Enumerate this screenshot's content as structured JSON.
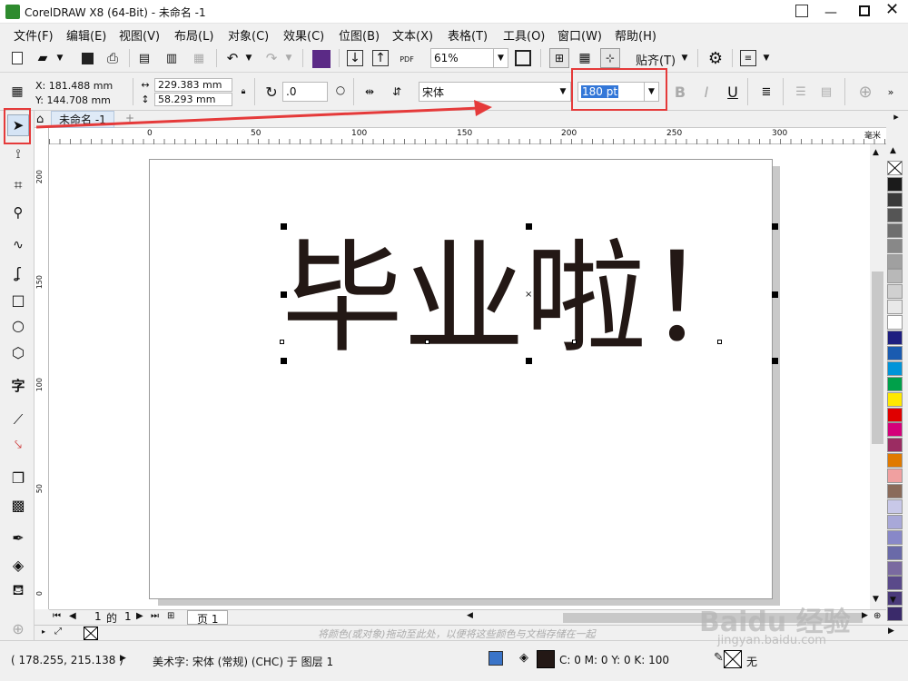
{
  "title": "CorelDRAW X8 (64-Bit) - 未命名 -1",
  "menu": [
    "文件(F)",
    "编辑(E)",
    "视图(V)",
    "布局(L)",
    "对象(C)",
    "效果(C)",
    "位图(B)",
    "文本(X)",
    "表格(T)",
    "工具(O)",
    "窗口(W)",
    "帮助(H)"
  ],
  "toolbar": {
    "zoom": "61%",
    "snap": "贴齐(T)"
  },
  "props": {
    "x": "X: 181.488 mm",
    "y": "Y: 144.708 mm",
    "w": "229.383 mm",
    "h": "58.293 mm",
    "angle": ".0",
    "font": "宋体",
    "size": "180 pt"
  },
  "tab": {
    "name": "未命名 -1"
  },
  "ruler": {
    "marks": [
      "0",
      "50",
      "100",
      "150",
      "200",
      "250",
      "300"
    ],
    "unit": "毫米",
    "vmarks": [
      "200",
      "150",
      "100",
      "50",
      "0"
    ]
  },
  "canvas_text": "毕业啦！",
  "pagenav": {
    "current": "1",
    "of": "的",
    "total": "1",
    "page_tab": "页 1"
  },
  "hint": "将颜色(或对象)拖动至此处，以便将这些颜色与文档存储在一起",
  "status": {
    "coords": "( 178.255, 215.138 )",
    "info": "美术字: 宋体 (常规) (CHC) 于 图层 1",
    "cmyk": "C: 0 M: 0 Y: 0 K: 100",
    "outline": "无"
  },
  "watermark": "Baidu 经验",
  "watermark_sub": "jingyan.baidu.com",
  "palette": [
    "#1b1b1b",
    "#3a3a3a",
    "#555555",
    "#6e6e6e",
    "#888888",
    "#a0a0a0",
    "#b8b8b8",
    "#d0d0d0",
    "#e8e8e8",
    "#ffffff",
    "#1e1e80",
    "#1a5bb0",
    "#0094d9",
    "#00a04a",
    "#ffe800",
    "#e00000",
    "#d4007a",
    "#9b2c62",
    "#e07a00",
    "#f0a0a0",
    "#8a6b5a",
    "#c8c8e8",
    "#a8a8d8",
    "#8888c8",
    "#6a6aa8",
    "#7a6aa0",
    "#5a4a8a",
    "#4a3a7a",
    "#3a2a6a"
  ]
}
